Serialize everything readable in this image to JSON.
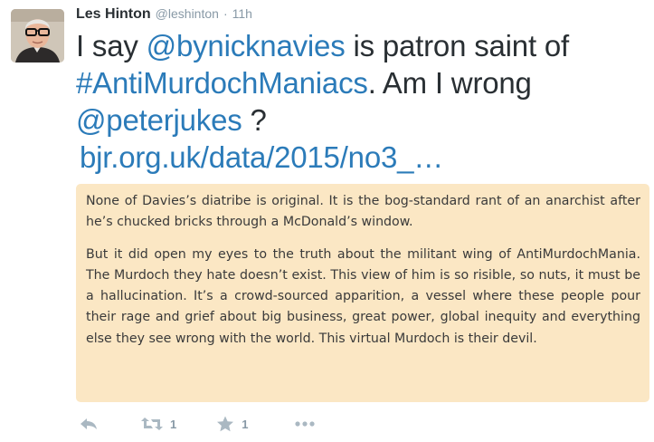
{
  "tweet": {
    "author_name": "Les Hinton",
    "author_handle": "@leshinton",
    "separator": "·",
    "time": "11h",
    "text_parts": {
      "t1": "I say ",
      "mention1": "@bynicknavies",
      "t2": " is patron saint of ",
      "hashtag": "#AntiMurdochManiacs",
      "t3": ". Am I wrong ",
      "mention2": "@peterjukes",
      "t4": " ?",
      "link": "bjr.org.uk/data/2015/no3_…"
    }
  },
  "card": {
    "paragraph1": "None of Davies’s diatribe is original. It is the bog-standard rant of an anarchist after he’s chucked bricks through a McDonald’s window.",
    "paragraph2": "But it did open my eyes to the truth about the militant wing of AntiMurdochMania. The Murdoch they hate doesn’t exist. This view of him is so risible, so nuts, it must be a hallucination. It’s a crowd-sourced apparition, a vessel where these people pour their rage and grief about big business, great power, global inequity and everything else they see wrong with the world. This virtual Murdoch is their devil."
  },
  "actions": {
    "retweet_count": "1",
    "favorite_count": "1"
  },
  "icons": {
    "reply": "reply-icon",
    "retweet": "retweet-icon",
    "favorite": "star-icon",
    "more": "more-icon"
  },
  "colors": {
    "link": "#2b7bb9",
    "card_background": "#fbe7c4",
    "action_icons": "#aab8c2"
  }
}
